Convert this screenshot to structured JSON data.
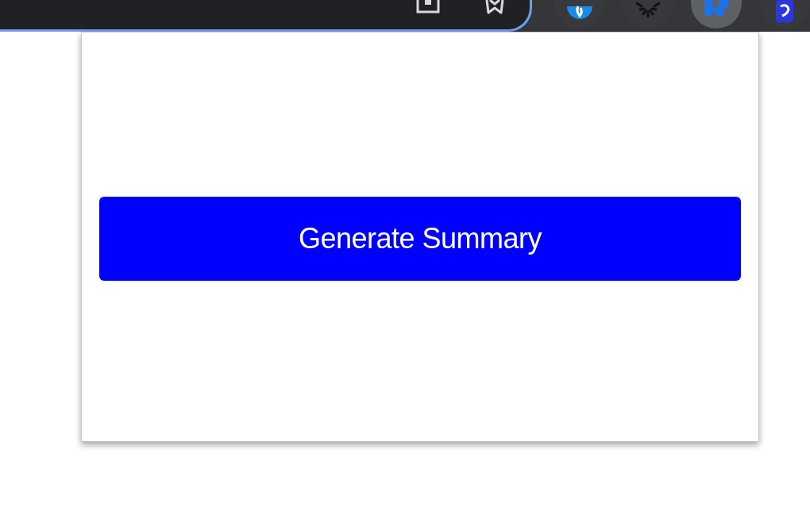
{
  "browser_toolbar": {
    "address_bar": {
      "focused": true
    },
    "extensions": [
      {
        "kind": "globe",
        "selected": false
      },
      {
        "kind": "burst",
        "selected": false
      },
      {
        "kind": "puzzle",
        "selected": true
      },
      {
        "kind": "tile",
        "selected": false
      }
    ]
  },
  "popup": {
    "button": {
      "label": "Generate Summary"
    }
  }
}
